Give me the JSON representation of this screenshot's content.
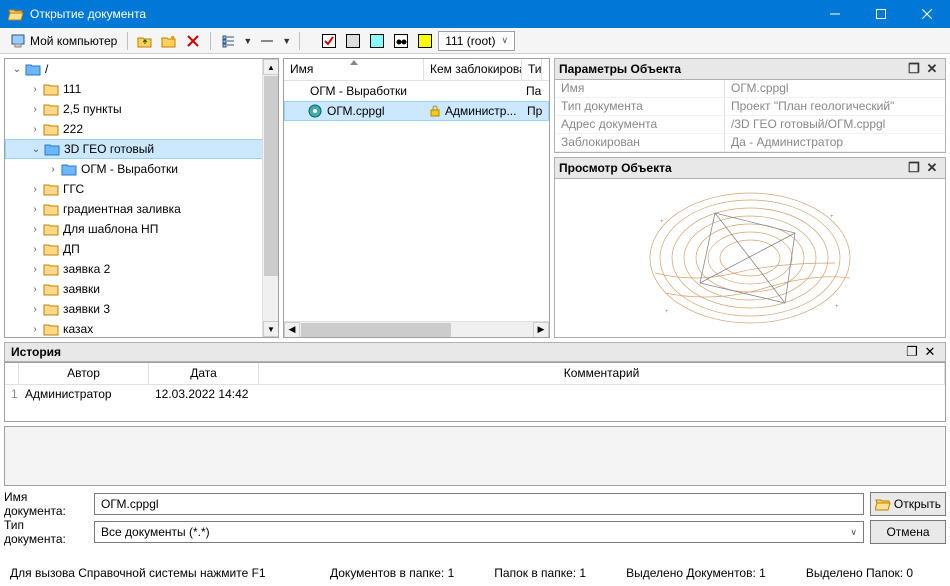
{
  "window": {
    "title": "Открытие документа"
  },
  "toolbar": {
    "my_computer": "Мой компьютер",
    "root_combo": "111 (root)"
  },
  "tree": {
    "root": "/",
    "items": [
      {
        "label": "111",
        "indent": 1
      },
      {
        "label": "2,5 пункты",
        "indent": 1
      },
      {
        "label": "222",
        "indent": 1
      },
      {
        "label": "3D ГЕО готовый",
        "indent": 1,
        "selected": true,
        "expanded": true
      },
      {
        "label": "ОГМ - Выработки",
        "indent": 2
      },
      {
        "label": "ГГС",
        "indent": 1
      },
      {
        "label": "градиентная заливка",
        "indent": 1
      },
      {
        "label": "Для шаблона НП",
        "indent": 1
      },
      {
        "label": "ДП",
        "indent": 1
      },
      {
        "label": "заявка 2",
        "indent": 1
      },
      {
        "label": "заявки",
        "indent": 1
      },
      {
        "label": "заявки 3",
        "indent": 1
      },
      {
        "label": "казах",
        "indent": 1
      }
    ]
  },
  "list": {
    "cols": [
      "Имя",
      "Кем заблокирова",
      "Ти"
    ],
    "rows": [
      {
        "name": "ОГМ - Выработки",
        "locked": "",
        "type": "Па",
        "icon": "folder"
      },
      {
        "name": "ОГМ.cppgl",
        "locked": "Администр...",
        "type": "Пр",
        "icon": "doc",
        "selected": true,
        "has_lock": true
      }
    ]
  },
  "params": {
    "title": "Параметры Объекта",
    "rows": [
      {
        "k": "Имя",
        "v": "ОГМ.cppgl"
      },
      {
        "k": "Тип документа",
        "v": "Проект \"План геологический\""
      },
      {
        "k": "Адрес документа",
        "v": "/3D ГЕО готовый/ОГМ.cppgl"
      },
      {
        "k": "Заблокирован",
        "v": "Да - Администратор"
      }
    ]
  },
  "preview": {
    "title": "Просмотр Объекта"
  },
  "history": {
    "title": "История",
    "cols": [
      "",
      "Автор",
      "Дата",
      "Комментарий"
    ],
    "rows": [
      {
        "n": "1",
        "author": "Администратор",
        "date": "12.03.2022 14:42",
        "comment": ""
      }
    ]
  },
  "form": {
    "name_label": "Имя документа:",
    "name_value": "ОГМ.cppgl",
    "type_label": "Тип документа:",
    "type_value": "Все документы (*.*)",
    "open": "Открыть",
    "cancel": "Отмена"
  },
  "status": {
    "help": "Для вызова Справочной системы нажмите F1",
    "docs": "Документов в папке: 1",
    "folders": "Папок в папке: 1",
    "sel_docs": "Выделено Документов: 1",
    "sel_folders": "Выделено Папок: 0"
  }
}
